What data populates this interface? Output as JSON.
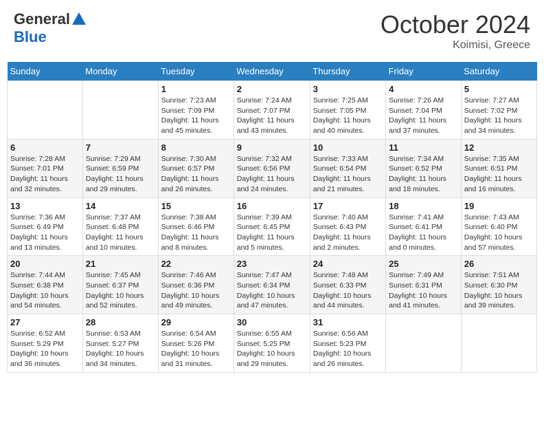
{
  "header": {
    "logo": {
      "general": "General",
      "blue": "Blue"
    },
    "title": "October 2024",
    "location": "Koimisi, Greece"
  },
  "days_of_week": [
    "Sunday",
    "Monday",
    "Tuesday",
    "Wednesday",
    "Thursday",
    "Friday",
    "Saturday"
  ],
  "weeks": [
    [
      {
        "day": "",
        "sunrise": "",
        "sunset": "",
        "daylight": ""
      },
      {
        "day": "",
        "sunrise": "",
        "sunset": "",
        "daylight": ""
      },
      {
        "day": "1",
        "sunrise": "Sunrise: 7:23 AM",
        "sunset": "Sunset: 7:09 PM",
        "daylight": "Daylight: 11 hours and 45 minutes."
      },
      {
        "day": "2",
        "sunrise": "Sunrise: 7:24 AM",
        "sunset": "Sunset: 7:07 PM",
        "daylight": "Daylight: 11 hours and 43 minutes."
      },
      {
        "day": "3",
        "sunrise": "Sunrise: 7:25 AM",
        "sunset": "Sunset: 7:05 PM",
        "daylight": "Daylight: 11 hours and 40 minutes."
      },
      {
        "day": "4",
        "sunrise": "Sunrise: 7:26 AM",
        "sunset": "Sunset: 7:04 PM",
        "daylight": "Daylight: 11 hours and 37 minutes."
      },
      {
        "day": "5",
        "sunrise": "Sunrise: 7:27 AM",
        "sunset": "Sunset: 7:02 PM",
        "daylight": "Daylight: 11 hours and 34 minutes."
      }
    ],
    [
      {
        "day": "6",
        "sunrise": "Sunrise: 7:28 AM",
        "sunset": "Sunset: 7:01 PM",
        "daylight": "Daylight: 11 hours and 32 minutes."
      },
      {
        "day": "7",
        "sunrise": "Sunrise: 7:29 AM",
        "sunset": "Sunset: 6:59 PM",
        "daylight": "Daylight: 11 hours and 29 minutes."
      },
      {
        "day": "8",
        "sunrise": "Sunrise: 7:30 AM",
        "sunset": "Sunset: 6:57 PM",
        "daylight": "Daylight: 11 hours and 26 minutes."
      },
      {
        "day": "9",
        "sunrise": "Sunrise: 7:32 AM",
        "sunset": "Sunset: 6:56 PM",
        "daylight": "Daylight: 11 hours and 24 minutes."
      },
      {
        "day": "10",
        "sunrise": "Sunrise: 7:33 AM",
        "sunset": "Sunset: 6:54 PM",
        "daylight": "Daylight: 11 hours and 21 minutes."
      },
      {
        "day": "11",
        "sunrise": "Sunrise: 7:34 AM",
        "sunset": "Sunset: 6:52 PM",
        "daylight": "Daylight: 11 hours and 18 minutes."
      },
      {
        "day": "12",
        "sunrise": "Sunrise: 7:35 AM",
        "sunset": "Sunset: 6:51 PM",
        "daylight": "Daylight: 11 hours and 16 minutes."
      }
    ],
    [
      {
        "day": "13",
        "sunrise": "Sunrise: 7:36 AM",
        "sunset": "Sunset: 6:49 PM",
        "daylight": "Daylight: 11 hours and 13 minutes."
      },
      {
        "day": "14",
        "sunrise": "Sunrise: 7:37 AM",
        "sunset": "Sunset: 6:48 PM",
        "daylight": "Daylight: 11 hours and 10 minutes."
      },
      {
        "day": "15",
        "sunrise": "Sunrise: 7:38 AM",
        "sunset": "Sunset: 6:46 PM",
        "daylight": "Daylight: 11 hours and 8 minutes."
      },
      {
        "day": "16",
        "sunrise": "Sunrise: 7:39 AM",
        "sunset": "Sunset: 6:45 PM",
        "daylight": "Daylight: 11 hours and 5 minutes."
      },
      {
        "day": "17",
        "sunrise": "Sunrise: 7:40 AM",
        "sunset": "Sunset: 6:43 PM",
        "daylight": "Daylight: 11 hours and 2 minutes."
      },
      {
        "day": "18",
        "sunrise": "Sunrise: 7:41 AM",
        "sunset": "Sunset: 6:41 PM",
        "daylight": "Daylight: 11 hours and 0 minutes."
      },
      {
        "day": "19",
        "sunrise": "Sunrise: 7:43 AM",
        "sunset": "Sunset: 6:40 PM",
        "daylight": "Daylight: 10 hours and 57 minutes."
      }
    ],
    [
      {
        "day": "20",
        "sunrise": "Sunrise: 7:44 AM",
        "sunset": "Sunset: 6:38 PM",
        "daylight": "Daylight: 10 hours and 54 minutes."
      },
      {
        "day": "21",
        "sunrise": "Sunrise: 7:45 AM",
        "sunset": "Sunset: 6:37 PM",
        "daylight": "Daylight: 10 hours and 52 minutes."
      },
      {
        "day": "22",
        "sunrise": "Sunrise: 7:46 AM",
        "sunset": "Sunset: 6:36 PM",
        "daylight": "Daylight: 10 hours and 49 minutes."
      },
      {
        "day": "23",
        "sunrise": "Sunrise: 7:47 AM",
        "sunset": "Sunset: 6:34 PM",
        "daylight": "Daylight: 10 hours and 47 minutes."
      },
      {
        "day": "24",
        "sunrise": "Sunrise: 7:48 AM",
        "sunset": "Sunset: 6:33 PM",
        "daylight": "Daylight: 10 hours and 44 minutes."
      },
      {
        "day": "25",
        "sunrise": "Sunrise: 7:49 AM",
        "sunset": "Sunset: 6:31 PM",
        "daylight": "Daylight: 10 hours and 41 minutes."
      },
      {
        "day": "26",
        "sunrise": "Sunrise: 7:51 AM",
        "sunset": "Sunset: 6:30 PM",
        "daylight": "Daylight: 10 hours and 39 minutes."
      }
    ],
    [
      {
        "day": "27",
        "sunrise": "Sunrise: 6:52 AM",
        "sunset": "Sunset: 5:29 PM",
        "daylight": "Daylight: 10 hours and 36 minutes."
      },
      {
        "day": "28",
        "sunrise": "Sunrise: 6:53 AM",
        "sunset": "Sunset: 5:27 PM",
        "daylight": "Daylight: 10 hours and 34 minutes."
      },
      {
        "day": "29",
        "sunrise": "Sunrise: 6:54 AM",
        "sunset": "Sunset: 5:26 PM",
        "daylight": "Daylight: 10 hours and 31 minutes."
      },
      {
        "day": "30",
        "sunrise": "Sunrise: 6:55 AM",
        "sunset": "Sunset: 5:25 PM",
        "daylight": "Daylight: 10 hours and 29 minutes."
      },
      {
        "day": "31",
        "sunrise": "Sunrise: 6:56 AM",
        "sunset": "Sunset: 5:23 PM",
        "daylight": "Daylight: 10 hours and 26 minutes."
      },
      {
        "day": "",
        "sunrise": "",
        "sunset": "",
        "daylight": ""
      },
      {
        "day": "",
        "sunrise": "",
        "sunset": "",
        "daylight": ""
      }
    ]
  ]
}
